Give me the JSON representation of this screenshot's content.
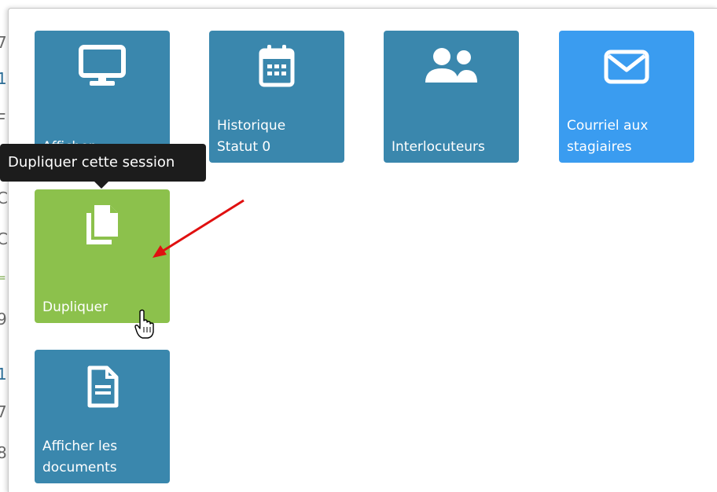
{
  "tooltip": {
    "text": "Dupliquer cette session"
  },
  "tiles": [
    {
      "label": "Afficher",
      "icon": "monitor-icon",
      "color": "#3a87ad"
    },
    {
      "label": "Historique\nStatut 0",
      "icon": "calendar-icon",
      "color": "#3a87ad"
    },
    {
      "label": "Interlocuteurs",
      "icon": "users-icon",
      "color": "#3a87ad"
    },
    {
      "label": "Courriel aux\nstagiaires",
      "icon": "envelope-icon",
      "color": "#3a9cf0"
    },
    {
      "label": "Dupliquer",
      "icon": "copy-icon",
      "color": "#8cc14c"
    },
    {
      "label": "Afficher les\ndocuments",
      "icon": "document-icon",
      "color": "#3a87ad"
    }
  ],
  "underlay_fragments": [
    "7",
    "1",
    "F",
    "C",
    "C",
    "=",
    "9",
    "1",
    "7",
    "8"
  ],
  "annotations": {
    "arrow_color": "#e01010",
    "cursor": "hand-pointer-icon"
  }
}
